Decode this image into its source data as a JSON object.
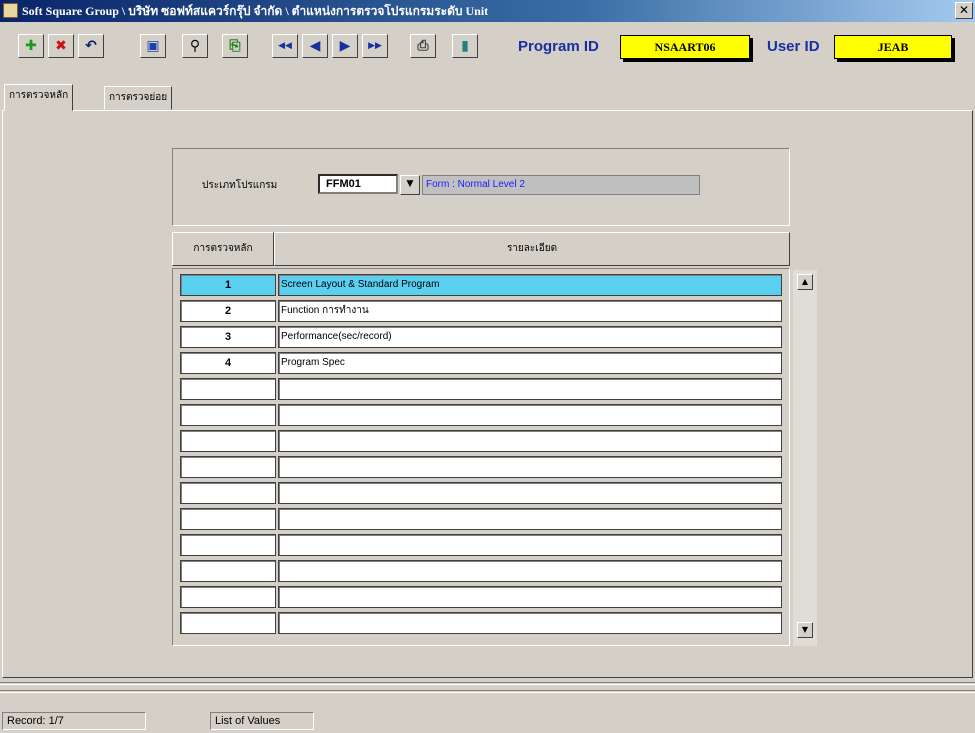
{
  "window": {
    "title": "Soft Square Group \\ บริษัท ซอฟท์สแควร์กรุ๊ป จำกัด \\ ตำแหน่งการตรวจโปรแกรมระดับ Unit",
    "close_glyph": "✕"
  },
  "toolbar": {
    "buttons": [
      {
        "name": "add",
        "glyph": "✚",
        "color": "#1a9a1a"
      },
      {
        "name": "delete",
        "glyph": "✖",
        "color": "#d01010"
      },
      {
        "name": "undo",
        "glyph": "↶",
        "color": "#0a246a"
      },
      {
        "name": "save",
        "glyph": "▣",
        "color": "#1a3fb0"
      },
      {
        "name": "find",
        "glyph": "⚲",
        "color": "#000000"
      },
      {
        "name": "query",
        "glyph": "⎘",
        "color": "#208020"
      },
      {
        "name": "first",
        "glyph": "◀◀",
        "color": "#1a2fa0"
      },
      {
        "name": "prev",
        "glyph": "◀",
        "color": "#1a2fa0"
      },
      {
        "name": "next",
        "glyph": "▶",
        "color": "#1a2fa0"
      },
      {
        "name": "last",
        "glyph": "▶▶",
        "color": "#1a2fa0"
      },
      {
        "name": "preview",
        "glyph": "⎙",
        "color": "#404040"
      },
      {
        "name": "exit",
        "glyph": "▮",
        "color": "#208080"
      }
    ],
    "program_id_label": "Program ID",
    "program_id_value": "NSAART06",
    "user_id_label": "User ID",
    "user_id_value": "JEAB"
  },
  "tabs": [
    {
      "label": "การตรวจหลัก",
      "active": true
    },
    {
      "label": "การตรวจย่อย",
      "active": false
    }
  ],
  "form": {
    "program_type_label": "ประเภทโปรแกรม",
    "program_type_value": "FFM01",
    "program_type_desc": "Form : Normal Level 2",
    "dropdown_glyph": "▼"
  },
  "grid": {
    "headers": [
      "การตรวจหลัก",
      "รายละเอียด"
    ],
    "rows": [
      {
        "no": "1",
        "desc": "Screen Layout & Standard Program",
        "selected": true
      },
      {
        "no": "2",
        "desc": "Function การทำงาน"
      },
      {
        "no": "3",
        "desc": "Performance(sec/record)"
      },
      {
        "no": "4",
        "desc": "Program Spec"
      },
      {
        "no": "",
        "desc": ""
      },
      {
        "no": "",
        "desc": ""
      },
      {
        "no": "",
        "desc": ""
      },
      {
        "no": "",
        "desc": ""
      },
      {
        "no": "",
        "desc": ""
      },
      {
        "no": "",
        "desc": ""
      },
      {
        "no": "",
        "desc": ""
      },
      {
        "no": "",
        "desc": ""
      },
      {
        "no": "",
        "desc": ""
      },
      {
        "no": "",
        "desc": ""
      }
    ],
    "scroll_up_glyph": "▲",
    "scroll_down_glyph": "▼"
  },
  "status": {
    "record": "Record: 1/7",
    "mode": "List of Values"
  }
}
